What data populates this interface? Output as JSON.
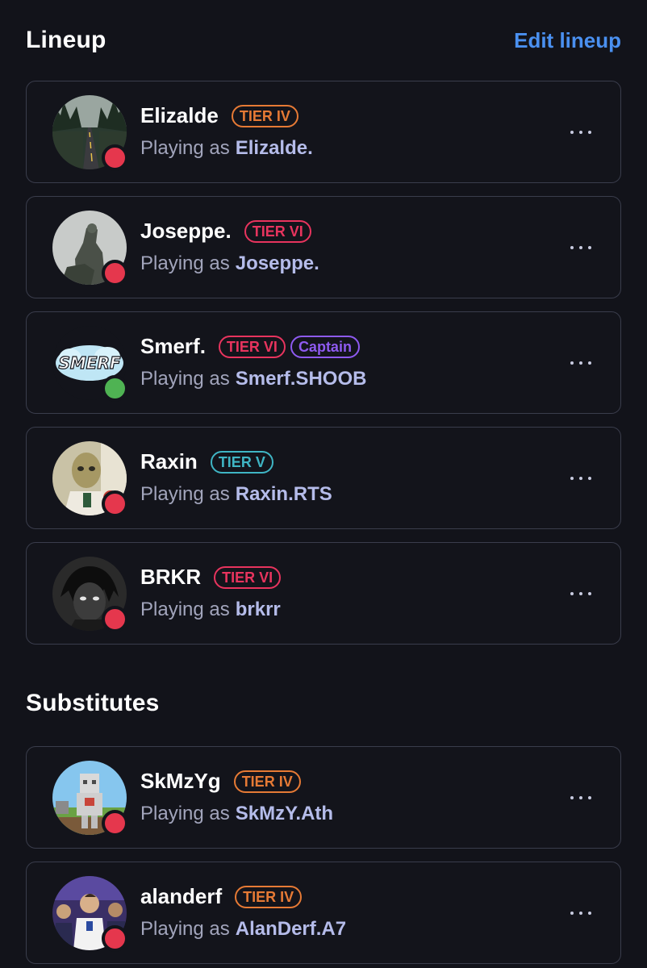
{
  "lineup": {
    "title": "Lineup",
    "edit_label": "Edit lineup",
    "players": [
      {
        "name": "Elizalde",
        "badges": [
          {
            "label": "TIER IV",
            "kind": "tier-iv"
          }
        ],
        "prefix": "Playing as",
        "handle": "Elizalde.",
        "status": "offline",
        "avatar": "road-forest"
      },
      {
        "name": "Joseppe.",
        "badges": [
          {
            "label": "TIER VI",
            "kind": "tier-vi"
          }
        ],
        "prefix": "Playing as",
        "handle": "Joseppe.",
        "status": "offline",
        "avatar": "statue"
      },
      {
        "name": "Smerf.",
        "badges": [
          {
            "label": "TIER VI",
            "kind": "tier-vi"
          },
          {
            "label": "Captain",
            "kind": "captain"
          }
        ],
        "prefix": "Playing as",
        "handle": "Smerf.SHOOB",
        "status": "online",
        "avatar": "smerf-logo"
      },
      {
        "name": "Raxin",
        "badges": [
          {
            "label": "TIER V",
            "kind": "tier-v"
          }
        ],
        "prefix": "Playing as",
        "handle": "Raxin.RTS",
        "status": "offline",
        "avatar": "alien-photo"
      },
      {
        "name": "BRKR",
        "badges": [
          {
            "label": "TIER VI",
            "kind": "tier-vi"
          }
        ],
        "prefix": "Playing as",
        "handle": "brkrr",
        "status": "offline",
        "avatar": "dark-sketch"
      }
    ]
  },
  "substitutes": {
    "title": "Substitutes",
    "players": [
      {
        "name": "SkMzYg",
        "badges": [
          {
            "label": "TIER IV",
            "kind": "tier-iv"
          }
        ],
        "prefix": "Playing as",
        "handle": "SkMzY.Ath",
        "status": "offline",
        "avatar": "minecraft"
      },
      {
        "name": "alanderf",
        "badges": [
          {
            "label": "TIER IV",
            "kind": "tier-iv"
          }
        ],
        "prefix": "Playing as",
        "handle": "AlanDerf.A7",
        "status": "offline",
        "avatar": "event-photo"
      }
    ]
  },
  "colors": {
    "background": "#12131a",
    "card_border": "#3a3d4c",
    "link": "#4a90f0",
    "offline": "#e5374d",
    "online": "#4fb353",
    "tier_iv": "#e67a35",
    "tier_vi": "#e8345e",
    "tier_v": "#3fb5c4",
    "captain": "#8e5af0"
  }
}
